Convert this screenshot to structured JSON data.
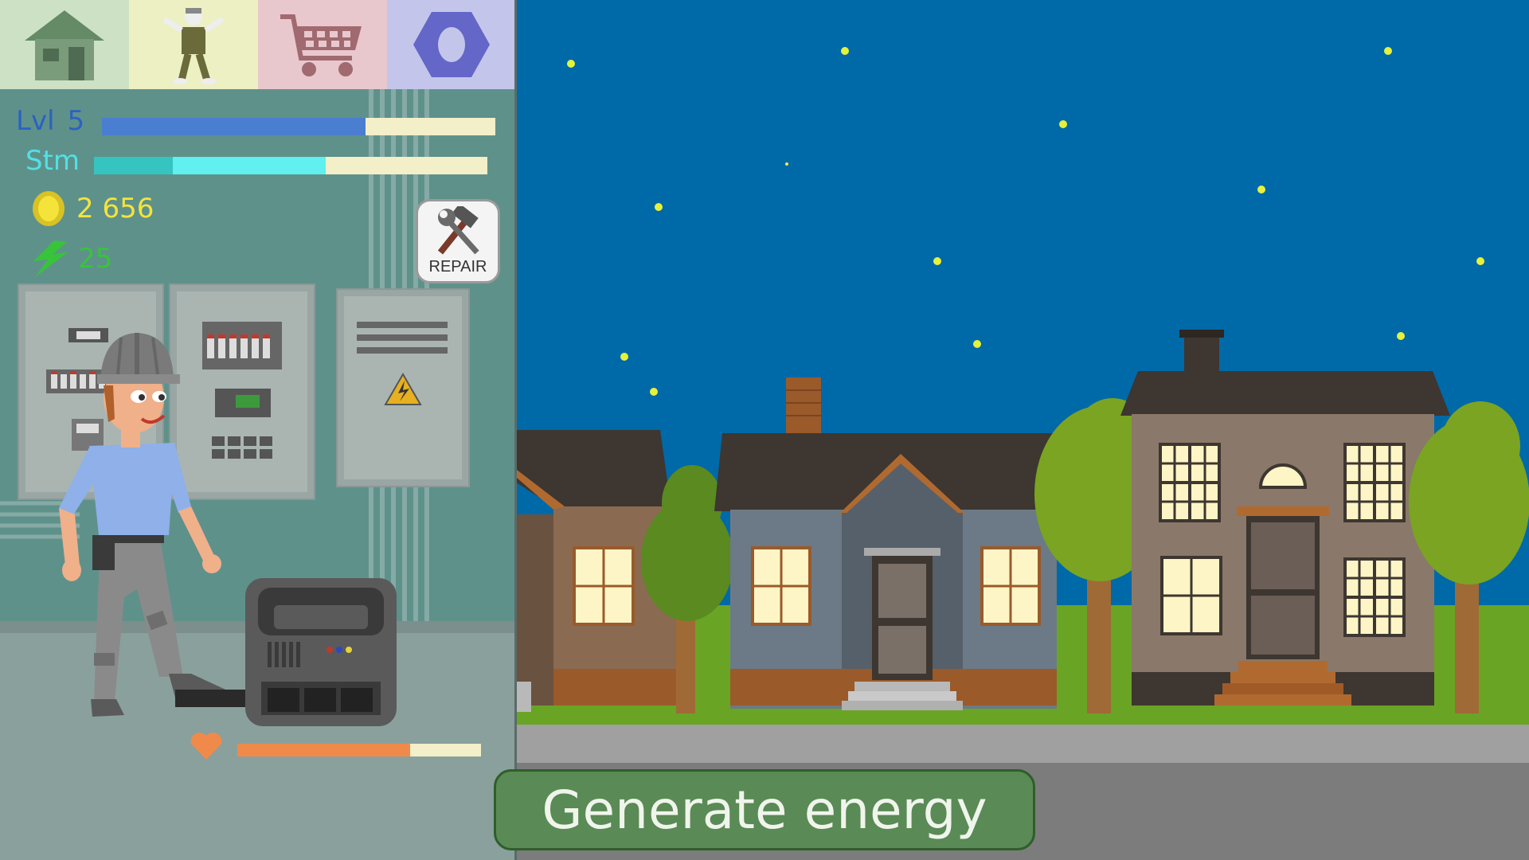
{
  "tabs": [
    {
      "name": "home",
      "icon": "house-icon",
      "bg": "#cde2c4"
    },
    {
      "name": "character",
      "icon": "character-icon",
      "bg": "#ecf0c3"
    },
    {
      "name": "shop",
      "icon": "shopping-cart-icon",
      "bg": "#e9c8cd"
    },
    {
      "name": "settings",
      "icon": "hex-nut-icon",
      "bg": "#c3c6ea"
    }
  ],
  "hud": {
    "level_label": "Lvl",
    "level_value": "5",
    "level_progress": 0.67,
    "stamina_label": "Stm",
    "stamina_progress_primary": 0.59,
    "stamina_progress_secondary": 0.2,
    "coins": "2 656",
    "energy": "25",
    "generator_health": 0.71
  },
  "repair_button": {
    "label": "REPAIR",
    "icon": "hammer-wrench-icon"
  },
  "generate_button": {
    "label": "Generate energy"
  },
  "colors": {
    "level_bar": "#4a7ed1",
    "stamina_primary": "#36c4c0",
    "stamina_secondary": "#5ff0ef",
    "bar_empty": "#f3efc8",
    "coin": "#f4e43a",
    "energy": "#37c43a",
    "health_bar": "#f08a4a",
    "sky": "#0069a8",
    "grass": "#6aa425",
    "star": "#e6f23a"
  }
}
